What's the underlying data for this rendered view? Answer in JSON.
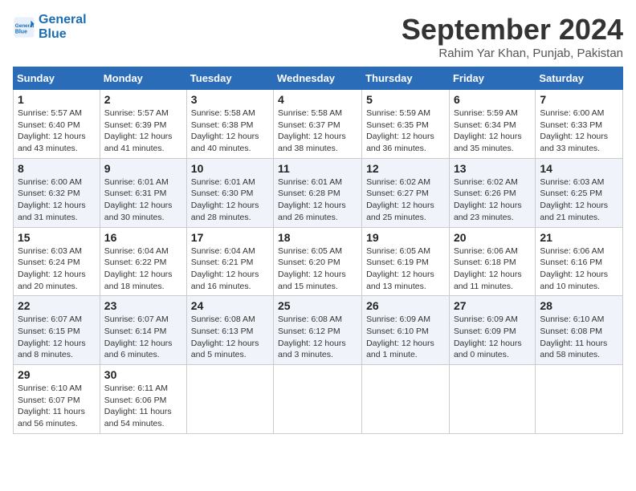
{
  "logo": {
    "line1": "General",
    "line2": "Blue"
  },
  "title": "September 2024",
  "location": "Rahim Yar Khan, Punjab, Pakistan",
  "headers": [
    "Sunday",
    "Monday",
    "Tuesday",
    "Wednesday",
    "Thursday",
    "Friday",
    "Saturday"
  ],
  "weeks": [
    [
      {
        "day": "1",
        "sunrise": "Sunrise: 5:57 AM",
        "sunset": "Sunset: 6:40 PM",
        "daylight": "Daylight: 12 hours and 43 minutes."
      },
      {
        "day": "2",
        "sunrise": "Sunrise: 5:57 AM",
        "sunset": "Sunset: 6:39 PM",
        "daylight": "Daylight: 12 hours and 41 minutes."
      },
      {
        "day": "3",
        "sunrise": "Sunrise: 5:58 AM",
        "sunset": "Sunset: 6:38 PM",
        "daylight": "Daylight: 12 hours and 40 minutes."
      },
      {
        "day": "4",
        "sunrise": "Sunrise: 5:58 AM",
        "sunset": "Sunset: 6:37 PM",
        "daylight": "Daylight: 12 hours and 38 minutes."
      },
      {
        "day": "5",
        "sunrise": "Sunrise: 5:59 AM",
        "sunset": "Sunset: 6:35 PM",
        "daylight": "Daylight: 12 hours and 36 minutes."
      },
      {
        "day": "6",
        "sunrise": "Sunrise: 5:59 AM",
        "sunset": "Sunset: 6:34 PM",
        "daylight": "Daylight: 12 hours and 35 minutes."
      },
      {
        "day": "7",
        "sunrise": "Sunrise: 6:00 AM",
        "sunset": "Sunset: 6:33 PM",
        "daylight": "Daylight: 12 hours and 33 minutes."
      }
    ],
    [
      {
        "day": "8",
        "sunrise": "Sunrise: 6:00 AM",
        "sunset": "Sunset: 6:32 PM",
        "daylight": "Daylight: 12 hours and 31 minutes."
      },
      {
        "day": "9",
        "sunrise": "Sunrise: 6:01 AM",
        "sunset": "Sunset: 6:31 PM",
        "daylight": "Daylight: 12 hours and 30 minutes."
      },
      {
        "day": "10",
        "sunrise": "Sunrise: 6:01 AM",
        "sunset": "Sunset: 6:30 PM",
        "daylight": "Daylight: 12 hours and 28 minutes."
      },
      {
        "day": "11",
        "sunrise": "Sunrise: 6:01 AM",
        "sunset": "Sunset: 6:28 PM",
        "daylight": "Daylight: 12 hours and 26 minutes."
      },
      {
        "day": "12",
        "sunrise": "Sunrise: 6:02 AM",
        "sunset": "Sunset: 6:27 PM",
        "daylight": "Daylight: 12 hours and 25 minutes."
      },
      {
        "day": "13",
        "sunrise": "Sunrise: 6:02 AM",
        "sunset": "Sunset: 6:26 PM",
        "daylight": "Daylight: 12 hours and 23 minutes."
      },
      {
        "day": "14",
        "sunrise": "Sunrise: 6:03 AM",
        "sunset": "Sunset: 6:25 PM",
        "daylight": "Daylight: 12 hours and 21 minutes."
      }
    ],
    [
      {
        "day": "15",
        "sunrise": "Sunrise: 6:03 AM",
        "sunset": "Sunset: 6:24 PM",
        "daylight": "Daylight: 12 hours and 20 minutes."
      },
      {
        "day": "16",
        "sunrise": "Sunrise: 6:04 AM",
        "sunset": "Sunset: 6:22 PM",
        "daylight": "Daylight: 12 hours and 18 minutes."
      },
      {
        "day": "17",
        "sunrise": "Sunrise: 6:04 AM",
        "sunset": "Sunset: 6:21 PM",
        "daylight": "Daylight: 12 hours and 16 minutes."
      },
      {
        "day": "18",
        "sunrise": "Sunrise: 6:05 AM",
        "sunset": "Sunset: 6:20 PM",
        "daylight": "Daylight: 12 hours and 15 minutes."
      },
      {
        "day": "19",
        "sunrise": "Sunrise: 6:05 AM",
        "sunset": "Sunset: 6:19 PM",
        "daylight": "Daylight: 12 hours and 13 minutes."
      },
      {
        "day": "20",
        "sunrise": "Sunrise: 6:06 AM",
        "sunset": "Sunset: 6:18 PM",
        "daylight": "Daylight: 12 hours and 11 minutes."
      },
      {
        "day": "21",
        "sunrise": "Sunrise: 6:06 AM",
        "sunset": "Sunset: 6:16 PM",
        "daylight": "Daylight: 12 hours and 10 minutes."
      }
    ],
    [
      {
        "day": "22",
        "sunrise": "Sunrise: 6:07 AM",
        "sunset": "Sunset: 6:15 PM",
        "daylight": "Daylight: 12 hours and 8 minutes."
      },
      {
        "day": "23",
        "sunrise": "Sunrise: 6:07 AM",
        "sunset": "Sunset: 6:14 PM",
        "daylight": "Daylight: 12 hours and 6 minutes."
      },
      {
        "day": "24",
        "sunrise": "Sunrise: 6:08 AM",
        "sunset": "Sunset: 6:13 PM",
        "daylight": "Daylight: 12 hours and 5 minutes."
      },
      {
        "day": "25",
        "sunrise": "Sunrise: 6:08 AM",
        "sunset": "Sunset: 6:12 PM",
        "daylight": "Daylight: 12 hours and 3 minutes."
      },
      {
        "day": "26",
        "sunrise": "Sunrise: 6:09 AM",
        "sunset": "Sunset: 6:10 PM",
        "daylight": "Daylight: 12 hours and 1 minute."
      },
      {
        "day": "27",
        "sunrise": "Sunrise: 6:09 AM",
        "sunset": "Sunset: 6:09 PM",
        "daylight": "Daylight: 12 hours and 0 minutes."
      },
      {
        "day": "28",
        "sunrise": "Sunrise: 6:10 AM",
        "sunset": "Sunset: 6:08 PM",
        "daylight": "Daylight: 11 hours and 58 minutes."
      }
    ],
    [
      {
        "day": "29",
        "sunrise": "Sunrise: 6:10 AM",
        "sunset": "Sunset: 6:07 PM",
        "daylight": "Daylight: 11 hours and 56 minutes."
      },
      {
        "day": "30",
        "sunrise": "Sunrise: 6:11 AM",
        "sunset": "Sunset: 6:06 PM",
        "daylight": "Daylight: 11 hours and 54 minutes."
      },
      null,
      null,
      null,
      null,
      null
    ]
  ]
}
